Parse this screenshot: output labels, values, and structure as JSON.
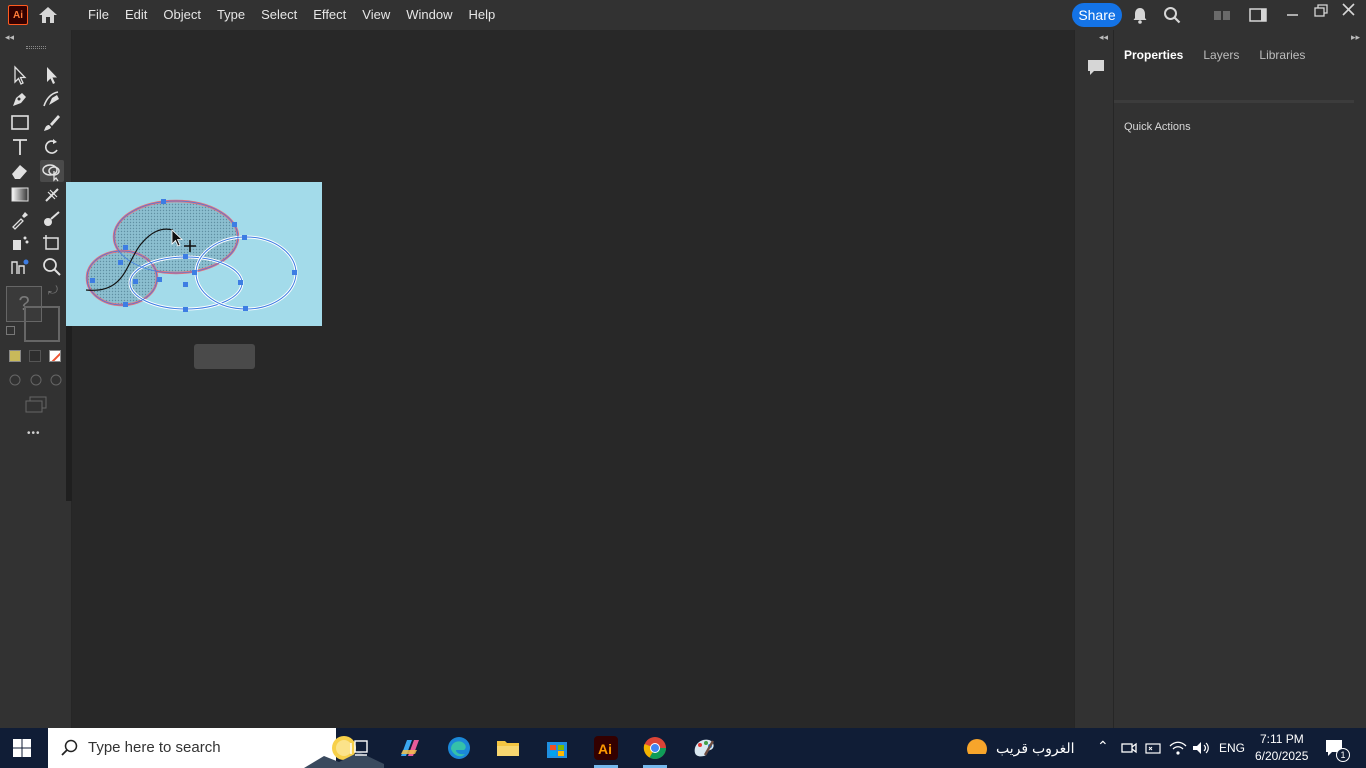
{
  "app": {
    "logo": "Ai",
    "menu": [
      "File",
      "Edit",
      "Object",
      "Type",
      "Select",
      "Effect",
      "View",
      "Window",
      "Help"
    ],
    "share_label": "Share"
  },
  "panel": {
    "tabs": [
      "Properties",
      "Layers",
      "Libraries"
    ],
    "active_tab": "Properties",
    "quick_actions": "Quick Actions"
  },
  "toolbar": {
    "help_glyph": "?",
    "more_glyph": "•••"
  },
  "taskbar": {
    "search_placeholder": "Type here to search",
    "weather_text": "الغروب قريب",
    "lang": "ENG",
    "time": "7:11 PM",
    "date": "6/20/2025",
    "notification_count": "1"
  },
  "colors": {
    "artboard": "#a3dbea",
    "selection": "#3d7de3",
    "path_highlight": "#e8707a",
    "share": "#1473e6",
    "taskbar": "#101d36"
  }
}
